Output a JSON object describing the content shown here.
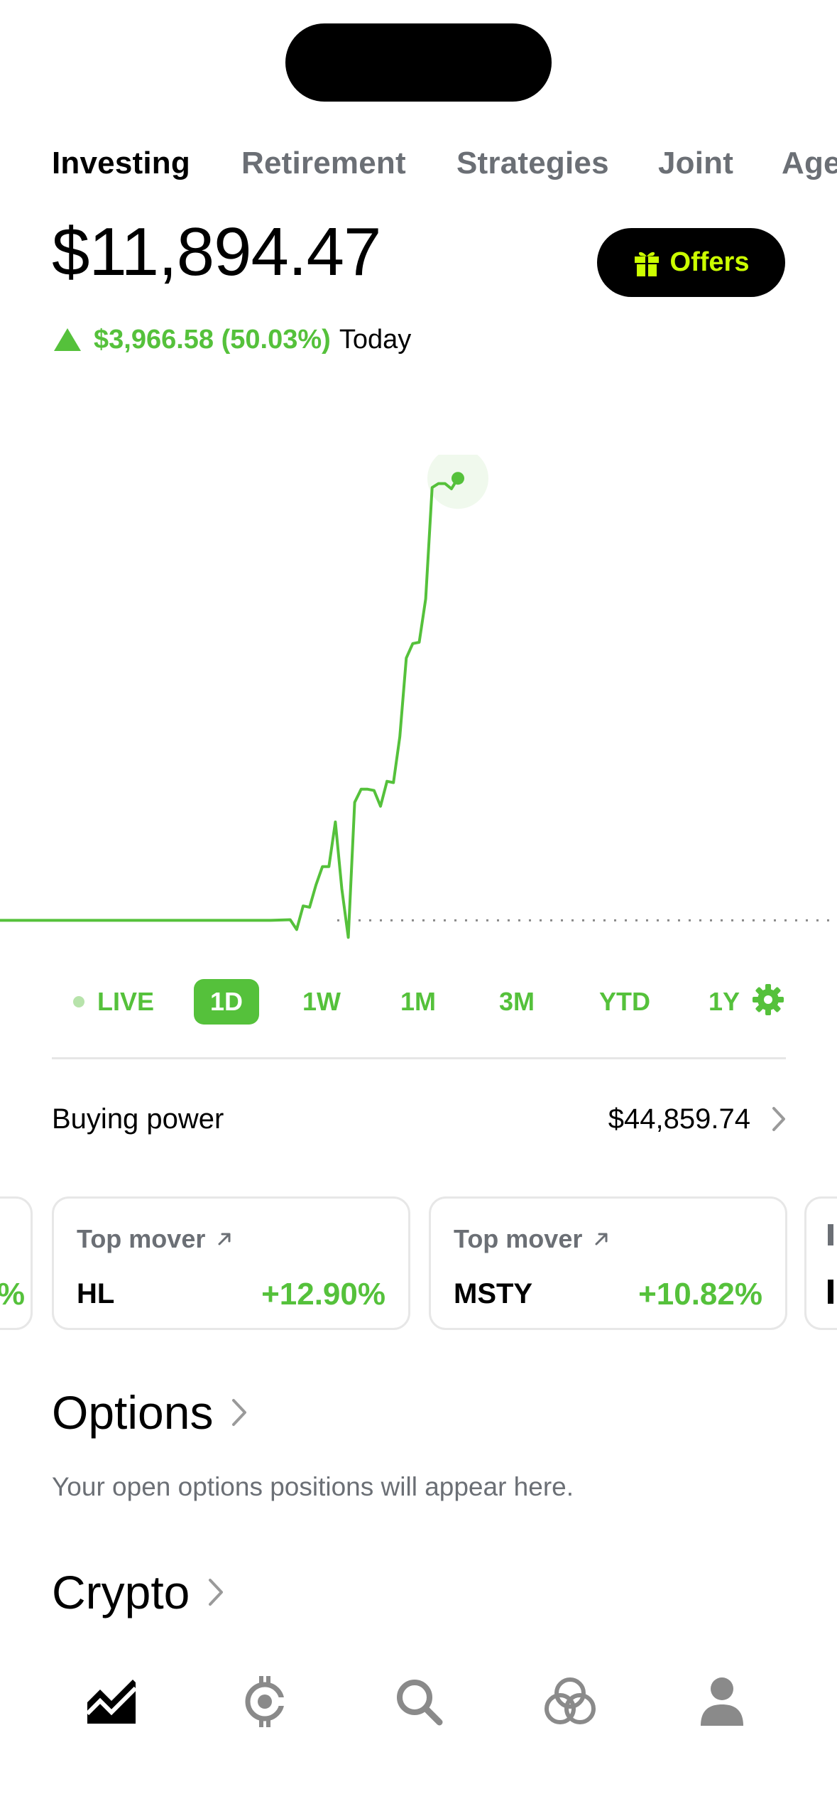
{
  "tabs": [
    "Investing",
    "Retirement",
    "Strategies",
    "Joint",
    "Agen"
  ],
  "portfolio": {
    "value": "$11,894.47",
    "change": "$3,966.58 (50.03%)",
    "period": "Today"
  },
  "offers": {
    "label": "Offers",
    "icon": "gift-icon"
  },
  "chart_data": {
    "type": "line",
    "x": [
      0,
      42,
      45,
      46,
      47,
      48,
      49,
      50,
      51,
      52,
      53,
      54,
      55,
      56,
      57,
      58,
      59,
      60,
      61,
      62,
      63,
      64,
      65,
      66,
      67,
      68,
      69,
      70,
      71
    ],
    "values": [
      6150,
      6150,
      6155,
      6080,
      6260,
      6250,
      6420,
      6560,
      6560,
      6900,
      6390,
      6020,
      7050,
      7150,
      7150,
      7140,
      7020,
      7210,
      7200,
      7550,
      8150,
      8260,
      8270,
      8600,
      9450,
      9480,
      9480,
      9440,
      9520
    ],
    "baseline": 6150,
    "color": "#55c13b"
  },
  "ranges": {
    "live": "LIVE",
    "items": [
      "1D",
      "1W",
      "1M",
      "3M",
      "YTD",
      "1Y"
    ],
    "active": "1D"
  },
  "buying_power": {
    "label": "Buying power",
    "value": "$44,859.74"
  },
  "movers": [
    {
      "label": "Top mover",
      "ticker": "HL",
      "change": "+12.90%"
    },
    {
      "label": "Top mover",
      "ticker": "MSTY",
      "change": "+10.82%"
    }
  ],
  "options": {
    "title": "Options",
    "subtitle": "Your open options positions will appear here."
  },
  "crypto": {
    "title": "Crypto"
  },
  "nav": [
    "investing-icon",
    "crypto-icon",
    "search-icon",
    "network-icon",
    "account-icon"
  ],
  "colors": {
    "accent": "#55c13b",
    "offers_text": "#ccff00"
  }
}
